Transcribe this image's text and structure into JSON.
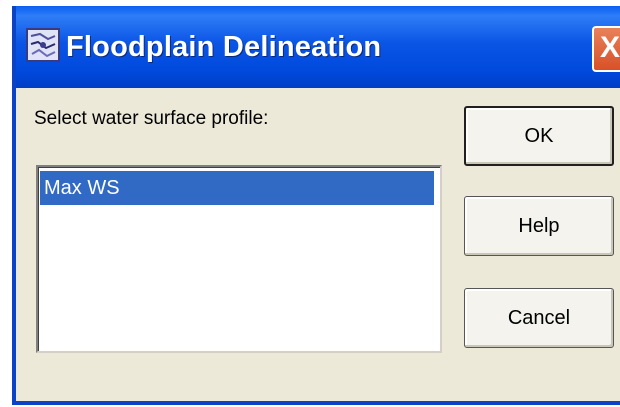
{
  "window": {
    "title": "Floodplain Delineation",
    "close_glyph": "X",
    "app_icon": "floodplain-app-icon"
  },
  "dialog": {
    "prompt": "Select water surface profile:",
    "profiles": [
      "Max WS"
    ],
    "selected_profile": "Max WS"
  },
  "buttons": {
    "ok": "OK",
    "help": "Help",
    "cancel": "Cancel"
  },
  "colors": {
    "titlebar": "#0b55e5",
    "selection": "#316ac5",
    "close_button": "#d85128",
    "dialog_bg": "#ece9d8"
  }
}
